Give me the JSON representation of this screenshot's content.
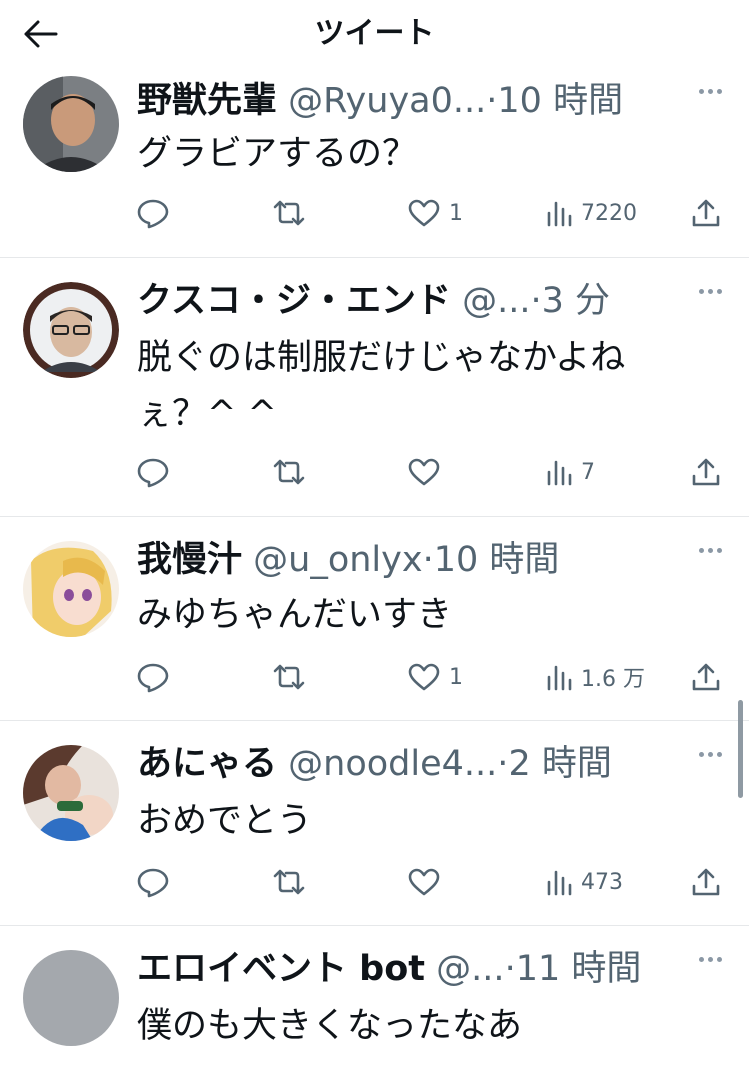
{
  "header": {
    "title": "ツイート"
  },
  "tweets": [
    {
      "name": "野獣先輩",
      "handle": "@Ryuya0...",
      "sep": "·",
      "time": "10 時間",
      "lines": [
        "グラビアするの？"
      ],
      "likes": "1",
      "views": "7220"
    },
    {
      "name": "クスコ・ジ・エンド",
      "handle": "@...",
      "sep": "·",
      "time": "3 分",
      "lines": [
        "脱ぐのは制服だけじゃなかよね",
        "ぇ？^ ^"
      ],
      "likes": "",
      "views": "7"
    },
    {
      "name": "我慢汁",
      "handle": "@u_onlyx",
      "sep": "·",
      "time": "10 時間",
      "lines": [
        "みゆちゃんだいすき"
      ],
      "likes": "1",
      "views": "1.6 万"
    },
    {
      "name": "あにゃる",
      "handle": "@noodle4...",
      "sep": "·",
      "time": "2 時間",
      "lines": [
        "おめでとう"
      ],
      "likes": "",
      "views": "473"
    },
    {
      "name": "エロイベント bot",
      "handle": "@...",
      "sep": "·",
      "time": "11 時間",
      "lines": [
        "僕のも大きくなったなあ"
      ],
      "likes": "",
      "views": ""
    }
  ]
}
